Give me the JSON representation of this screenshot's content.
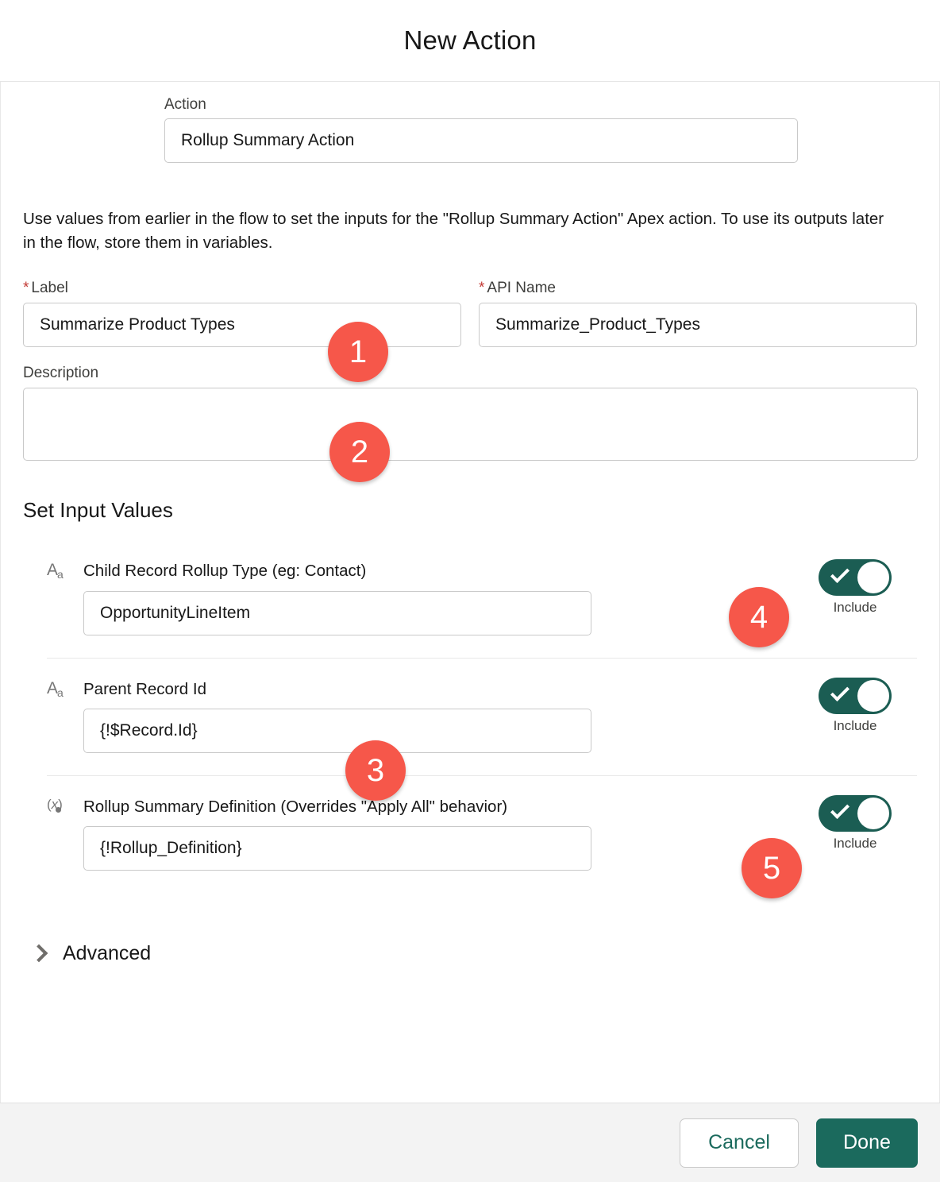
{
  "header": {
    "title": "New Action"
  },
  "action": {
    "label": "Action",
    "value": "Rollup Summary Action"
  },
  "help_text": "Use values from earlier in the flow to set the inputs for the \"Rollup Summary Action\" Apex action. To use its outputs later in the flow, store them in variables.",
  "fields": {
    "label": {
      "label": "Label",
      "value": "Summarize Product Types",
      "required_mark": "*"
    },
    "api_name": {
      "label": "API Name",
      "value": "Summarize_Product_Types",
      "required_mark": "*"
    },
    "description": {
      "label": "Description",
      "value": "",
      "placeholder": ""
    }
  },
  "set_input_values": {
    "section_title": "Set Input Values",
    "rows": [
      {
        "icon": "text-type-icon",
        "name": "Child Record Rollup Type (eg: Contact)",
        "value": "OpportunityLineItem",
        "toggle_label": "Include",
        "toggle_on": true
      },
      {
        "icon": "text-type-icon",
        "name": "Parent Record Id",
        "value": "{!$Record.Id}",
        "toggle_label": "Include",
        "toggle_on": true
      },
      {
        "icon": "apex-variable-icon",
        "name": "Rollup Summary Definition (Overrides \"Apply All\" behavior)",
        "value": "{!Rollup_Definition}",
        "toggle_label": "Include",
        "toggle_on": true
      }
    ]
  },
  "advanced": {
    "label": "Advanced",
    "icon": "chevron-right-icon",
    "expanded": false
  },
  "footer": {
    "cancel_label": "Cancel",
    "done_label": "Done"
  },
  "annotations": [
    {
      "number": "1",
      "target": "label-field"
    },
    {
      "number": "2",
      "target": "description-field"
    },
    {
      "number": "3",
      "target": "parent-record-id-field"
    },
    {
      "number": "4",
      "target": "child-record-rollup-type-toggle"
    },
    {
      "number": "5",
      "target": "rollup-summary-definition-toggle"
    }
  ],
  "colors": {
    "accent_green": "#1b6a5d",
    "toggle_green": "#1b5d53",
    "badge_red": "#f6574a",
    "required_red": "#c23934"
  }
}
